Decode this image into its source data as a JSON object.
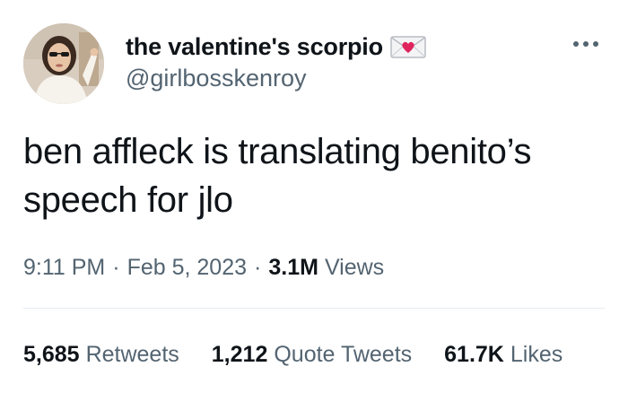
{
  "author": {
    "display_name": "the valentine's scorpio",
    "handle": "@girlbosskenroy",
    "avatar_icon": "profile-photo",
    "name_emoji_icon": "love-letter-envelope-icon"
  },
  "tweet": {
    "text": "ben affleck is translating benito’s\nspeech for jlo"
  },
  "meta": {
    "time": "9:11 PM",
    "separator": "·",
    "date": "Feb 5, 2023",
    "views_count": "3.1M",
    "views_label": "Views"
  },
  "stats": {
    "retweets_count": "5,685",
    "retweets_label": "Retweets",
    "quotes_count": "1,212",
    "quotes_label": "Quote Tweets",
    "likes_count": "61.7K",
    "likes_label": "Likes"
  },
  "colors": {
    "text_primary": "#0f1419",
    "text_secondary": "#536471",
    "heart": "#e0245e",
    "divider": "#e6ecf0"
  }
}
